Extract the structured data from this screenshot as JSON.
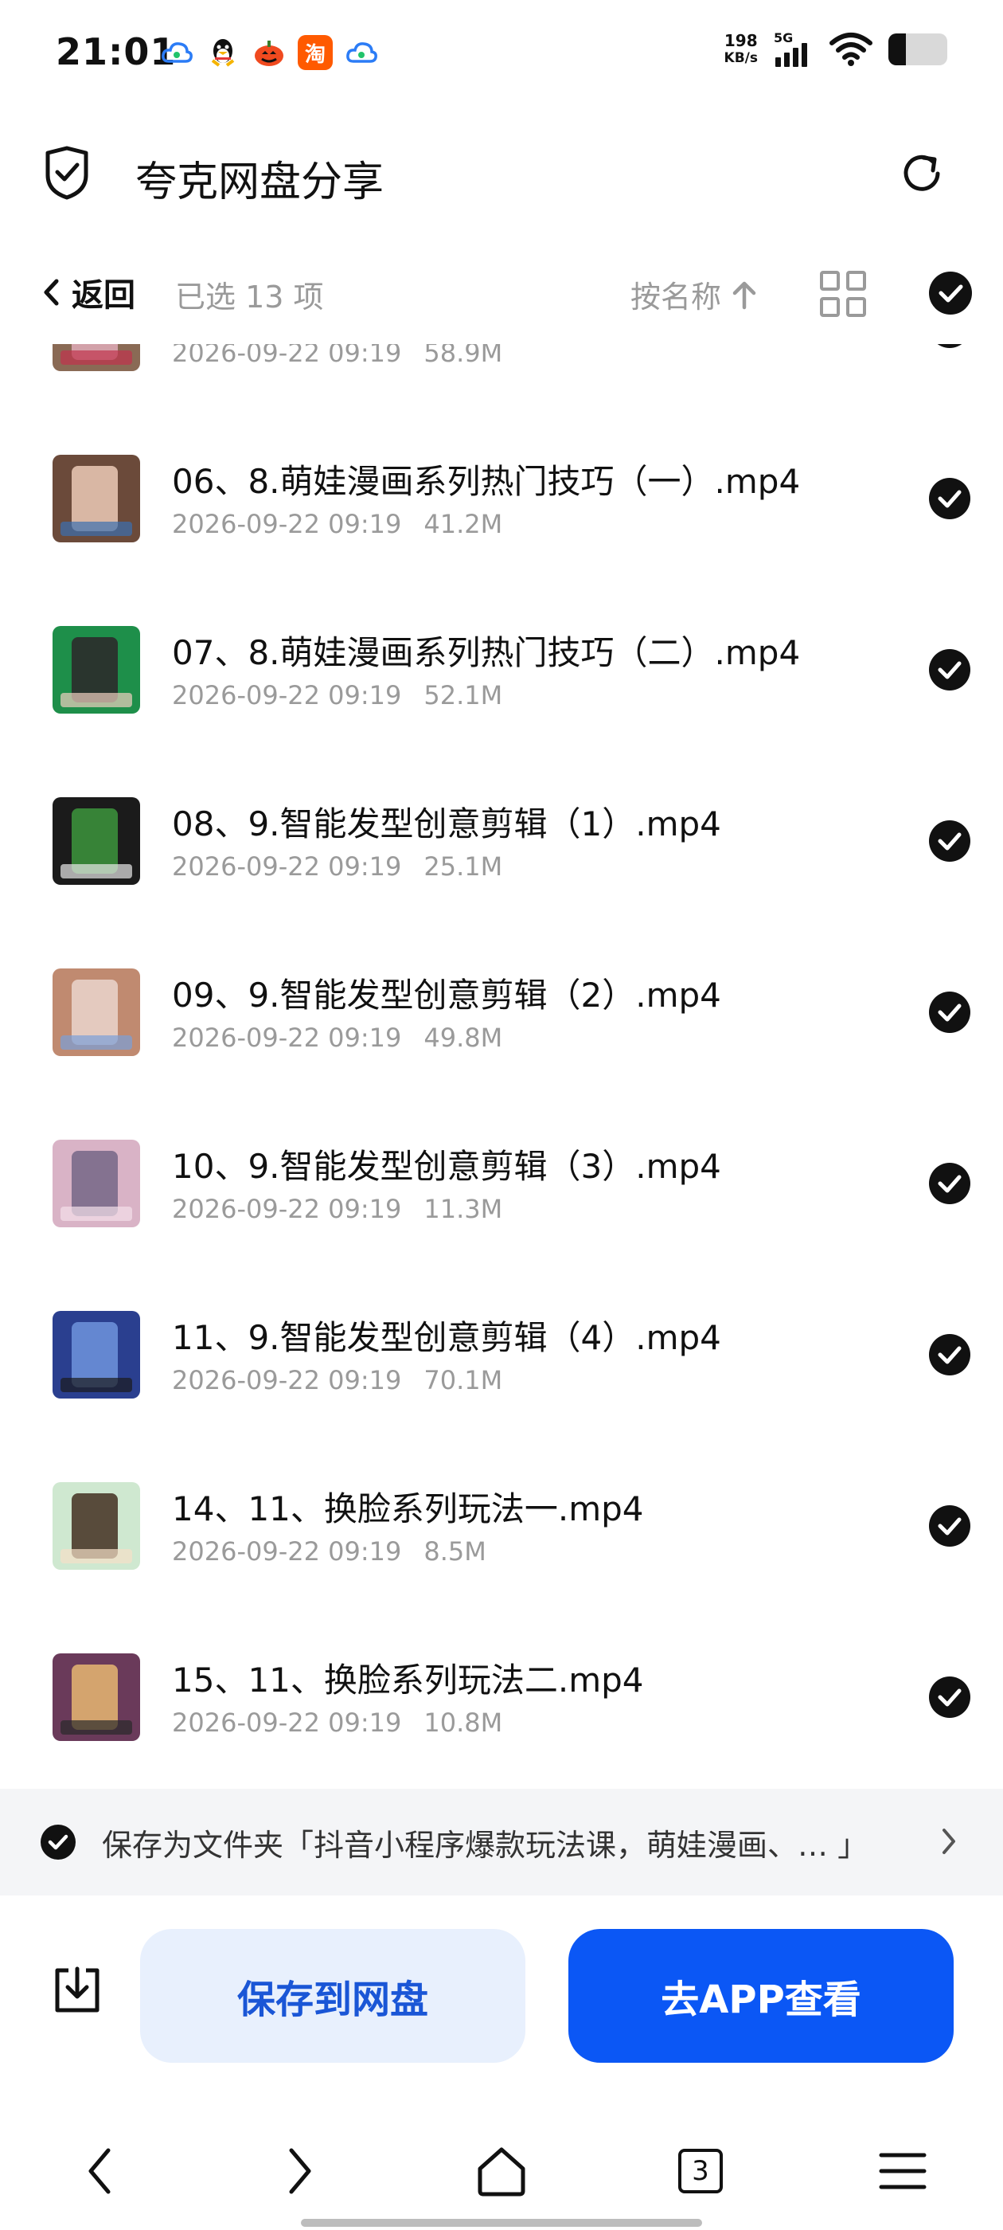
{
  "status_bar": {
    "time": "21:01",
    "net_speed_value": "198",
    "net_speed_unit": "KB/s",
    "network_type": "5G",
    "app_icons": [
      "cloud-icon",
      "qq-penguin-icon",
      "pumpkin-icon",
      "taobao-icon",
      "cloud-icon"
    ],
    "taobao_label": "淘",
    "battery_level": 0.3
  },
  "header": {
    "title": "夸克网盘分享"
  },
  "toolbar": {
    "back_label": "返回",
    "selected_text": "已选 13 项",
    "sort_label": "按名称"
  },
  "files": [
    {
      "name": "",
      "date": "2026-09-22 09:19",
      "size": "58.9M",
      "checked": true
    },
    {
      "name": "06、8.萌娃漫画系列热门技巧（一）.mp4",
      "date": "2026-09-22 09:19",
      "size": "41.2M",
      "checked": true
    },
    {
      "name": "07、8.萌娃漫画系列热门技巧（二）.mp4",
      "date": "2026-09-22 09:19",
      "size": "52.1M",
      "checked": true
    },
    {
      "name": "08、9.智能发型创意剪辑（1）.mp4",
      "date": "2026-09-22 09:19",
      "size": "25.1M",
      "checked": true
    },
    {
      "name": "09、9.智能发型创意剪辑（2）.mp4",
      "date": "2026-09-22 09:19",
      "size": "49.8M",
      "checked": true
    },
    {
      "name": "10、9.智能发型创意剪辑（3）.mp4",
      "date": "2026-09-22 09:19",
      "size": "11.3M",
      "checked": true
    },
    {
      "name": "11、9.智能发型创意剪辑（4）.mp4",
      "date": "2026-09-22 09:19",
      "size": "70.1M",
      "checked": true
    },
    {
      "name": "14、11、换脸系列玩法一.mp4",
      "date": "2026-09-22 09:19",
      "size": "8.5M",
      "checked": true
    },
    {
      "name": "15、11、换脸系列玩法二.mp4",
      "date": "2026-09-22 09:19",
      "size": "10.8M",
      "checked": true
    }
  ],
  "save_banner": {
    "text": "保存为文件夹「抖音小程序爆款玩法课，萌娃漫画、… 」"
  },
  "actions": {
    "save_label": "保存到网盘",
    "app_label": "去APP查看"
  },
  "browser_nav": {
    "tab_count": "3"
  },
  "colors": {
    "accent": "#0b57f5",
    "save_button_bg": "#e8f0fd",
    "save_button_text": "#1a56d6",
    "meta_gray": "#9a9a9a",
    "banner_bg": "#f4f5f7"
  }
}
